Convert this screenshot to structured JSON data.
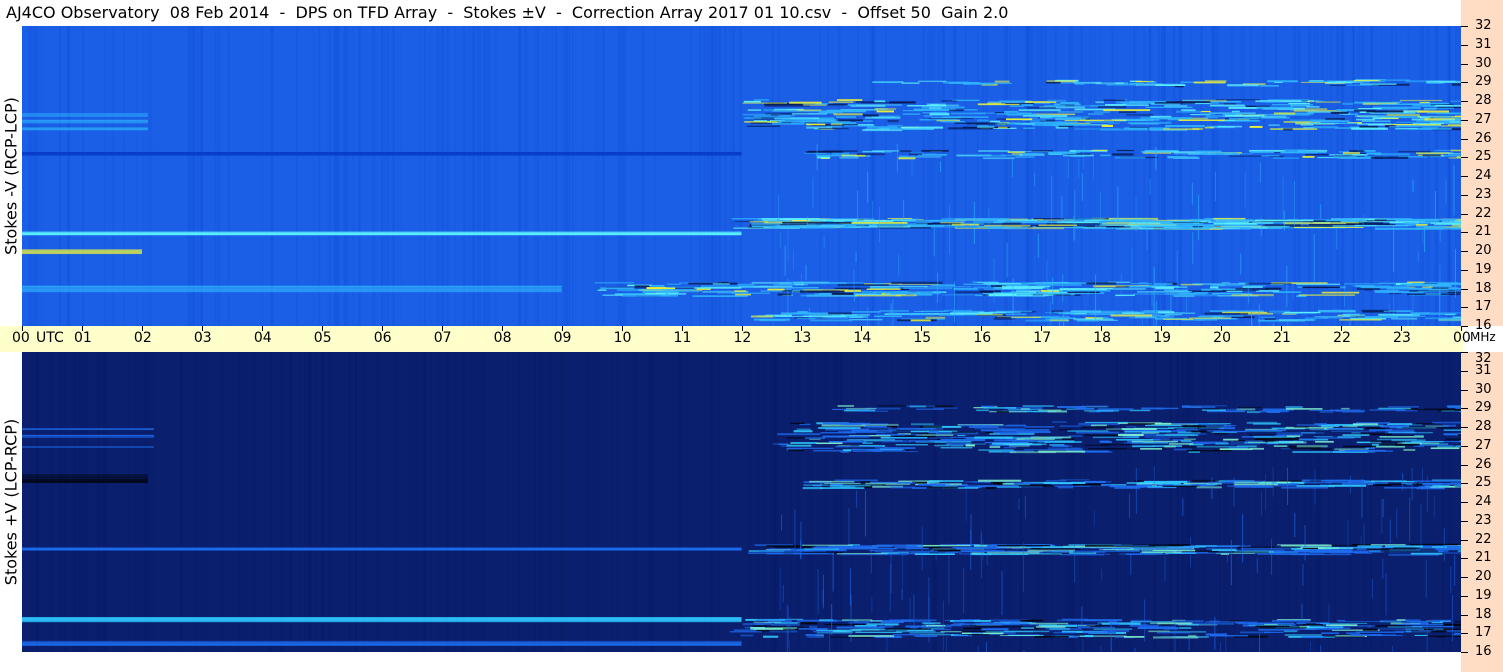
{
  "title": "AJ4CO Observatory  08 Feb 2014  -  DPS on TFD Array  -  Stokes ±V  -  Correction Array 2017 01 10.csv  -  Offset 50  Gain 2.0",
  "colors": {
    "background": "#ffffff",
    "time_axis_bg": "#ffffcc",
    "freq_axis_bg": "#ffdcc4",
    "panel_top_base": "#1a5fe6",
    "panel_bottom_base": "#0a1f6e"
  },
  "chart_data": [
    {
      "type": "heatmap",
      "name": "stokes-minus-v",
      "ylabel": "Stokes -V (RCP-LCP)",
      "x_range_utc_hours": [
        0,
        24
      ],
      "y_range_mhz": [
        16,
        32
      ],
      "time_ticks": [
        "00",
        "01",
        "02",
        "03",
        "04",
        "05",
        "06",
        "07",
        "08",
        "09",
        "10",
        "11",
        "12",
        "13",
        "14",
        "15",
        "16",
        "17",
        "18",
        "19",
        "20",
        "21",
        "22",
        "23",
        "00"
      ],
      "time_unit": "UTC",
      "freq_ticks": [
        "32",
        "31",
        "30",
        "29",
        "28",
        "27",
        "26",
        "25",
        "24",
        "23",
        "22",
        "21",
        "20",
        "19",
        "18",
        "17",
        "16"
      ],
      "freq_unit": "MHz",
      "colormap": "blue-cyan-yellow-red",
      "base_color": "#1a5fe6"
    },
    {
      "type": "heatmap",
      "name": "stokes-plus-v",
      "ylabel": "Stokes +V (LCP-RCP)",
      "x_range_utc_hours": [
        0,
        24
      ],
      "y_range_mhz": [
        16,
        32
      ],
      "freq_ticks": [
        "32",
        "31",
        "30",
        "29",
        "28",
        "27",
        "26",
        "25",
        "24",
        "23",
        "22",
        "21",
        "20",
        "19",
        "18",
        "17",
        "16"
      ],
      "colormap": "navy-blue-cyan",
      "base_color": "#0a1f6e"
    }
  ]
}
